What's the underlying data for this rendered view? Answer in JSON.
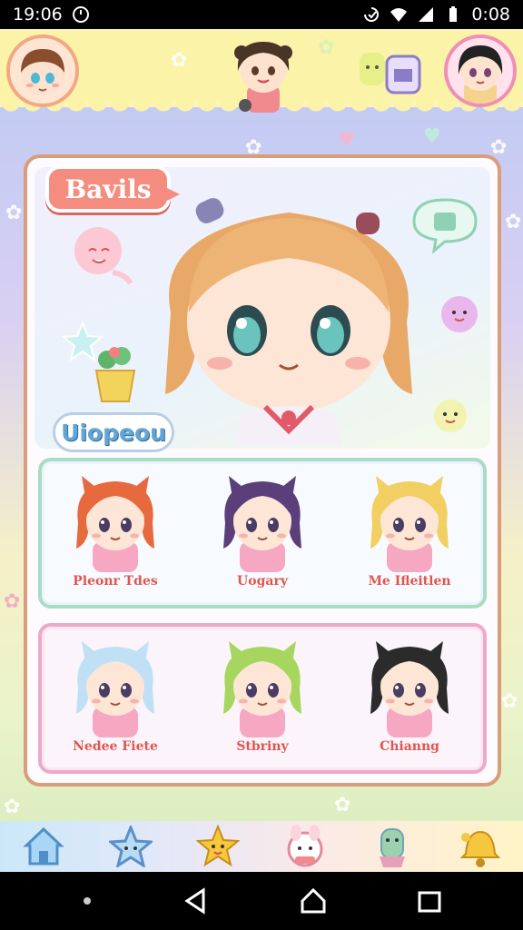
{
  "status_bar": {
    "time_left": "19:06",
    "time_right": "0:08"
  },
  "header": {
    "left_avatar": "boy-avatar",
    "right_avatar": "girl-avatar",
    "center_character": "chibi-girl-mascot"
  },
  "main": {
    "title": "Bavils",
    "featured_name": "Uiopeou",
    "rows": [
      {
        "characters": [
          {
            "name": "Pleonr Tdes",
            "hair": "#e66a3e"
          },
          {
            "name": "Uogary",
            "hair": "#5b3f7a"
          },
          {
            "name": "Me Ifleitlen",
            "hair": "#f2cf62"
          }
        ]
      },
      {
        "characters": [
          {
            "name": "Nedee Fiete",
            "hair": "#bfe0f5"
          },
          {
            "name": "Stbriny",
            "hair": "#a7d65e"
          },
          {
            "name": "Chianng",
            "hair": "#2b2b2b"
          }
        ]
      }
    ]
  },
  "bottom_nav": {
    "items": [
      "home-icon",
      "star-icon",
      "star-face-icon",
      "bunny-icon",
      "cactus-icon",
      "bell-icon"
    ]
  },
  "colors": {
    "accent": "#f48d7f",
    "card_border": "#d99d7c",
    "panel_green": "#a9dcc0",
    "panel_pink": "#ecaac8"
  }
}
